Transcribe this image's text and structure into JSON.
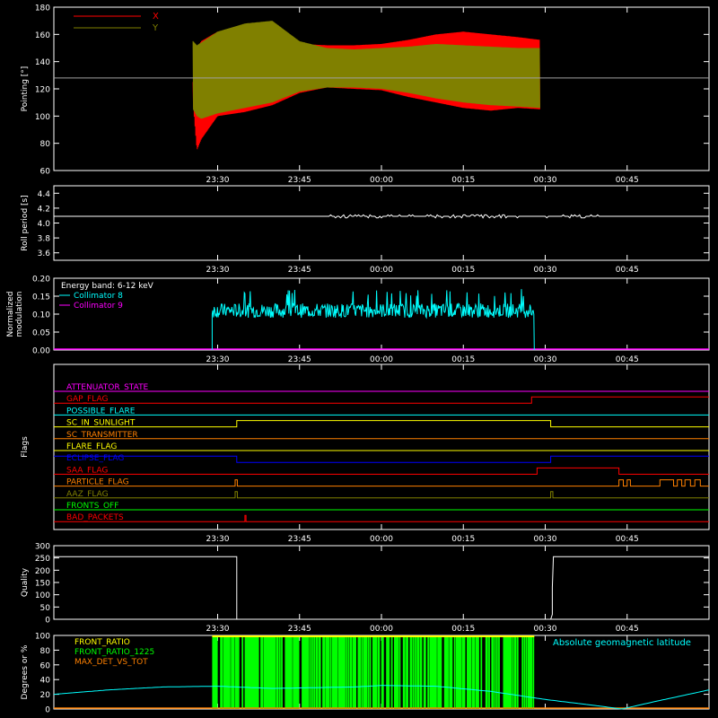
{
  "time_ticks": [
    "23:30",
    "23:45",
    "00:00",
    "00:15",
    "00:30",
    "00:45"
  ],
  "chart_data": [
    {
      "id": "pointing",
      "type": "line",
      "ylabel": "Pointing [°]",
      "ylim": [
        60,
        180
      ],
      "yticks": [
        60,
        80,
        100,
        120,
        140,
        160,
        180
      ],
      "ytick_labels": [
        "60",
        "80",
        "100",
        "120",
        "140",
        "160",
        "180"
      ],
      "xlim_minutes": [
        -30,
        90
      ],
      "grid": false,
      "legend": "top-left",
      "series": [
        {
          "name": "X",
          "color": "#ff0000",
          "kind": "oscillation",
          "t": [
            -4.5,
            -3.8,
            -3,
            0,
            5,
            10,
            15,
            20,
            25,
            30,
            35,
            40,
            45,
            50,
            55,
            59
          ],
          "hi": [
            125,
            150,
            155,
            162,
            166,
            165,
            153,
            152,
            152,
            153,
            156,
            160,
            162,
            160,
            158,
            156
          ],
          "lo": [
            110,
            75,
            83,
            100,
            103,
            108,
            117,
            121,
            120,
            119,
            114,
            110,
            106,
            104,
            106,
            105
          ]
        },
        {
          "name": "Y",
          "color": "#808000",
          "kind": "oscillation",
          "t": [
            -4.5,
            -3.8,
            -3,
            0,
            5,
            10,
            15,
            20,
            25,
            30,
            35,
            40,
            45,
            50,
            55,
            59
          ],
          "hi": [
            155,
            152,
            154,
            162,
            168,
            170,
            155,
            150,
            149,
            150,
            151,
            153,
            152,
            151,
            150,
            150
          ],
          "lo": [
            105,
            100,
            98,
            102,
            106,
            110,
            118,
            121,
            121,
            120,
            117,
            113,
            110,
            108,
            107,
            106
          ]
        }
      ],
      "reference_line": {
        "value": 128,
        "color": "#a0a0a0"
      }
    },
    {
      "id": "roll",
      "type": "line",
      "ylabel": "Roll period [s]",
      "ylim": [
        3.5,
        4.5
      ],
      "yticks": [
        3.6,
        3.8,
        4.0,
        4.2,
        4.4
      ],
      "ytick_labels": [
        "3.6",
        "3.8",
        "4.0",
        "4.2",
        "4.4"
      ],
      "series": [
        {
          "name": "",
          "color": "#ffffff",
          "value": 4.09,
          "jitter": 0.02
        }
      ]
    },
    {
      "id": "modulation",
      "type": "line",
      "ylabel": "Normalized modulation",
      "ylim": [
        0,
        0.2
      ],
      "yticks": [
        0,
        0.05,
        0.1,
        0.15,
        0.2
      ],
      "ytick_labels": [
        "0.00",
        "0.05",
        "0.10",
        "0.15",
        "0.20"
      ],
      "annotation": "Energy band: 6-12 keV",
      "legend": "top-left",
      "series": [
        {
          "name": "Collimator 8",
          "color": "#00ffff",
          "start": -1,
          "end": 58,
          "mean": 0.11,
          "noise": 0.02,
          "spikes": 0.17
        },
        {
          "name": "Collimator 9",
          "color": "#ff00ff",
          "value": 0.0
        }
      ]
    },
    {
      "id": "flags",
      "type": "line",
      "ylabel": "Flags",
      "flags": [
        {
          "name": "ATTENUATOR_STATE",
          "color": "#ff00ff",
          "segments": [
            [
              -30,
              0
            ]
          ]
        },
        {
          "name": "GAP_FLAG",
          "color": "#ff0000",
          "segments": [
            [
              -30,
              0
            ],
            [
              57.5,
              1
            ]
          ]
        },
        {
          "name": "POSSIBLE_FLARE",
          "color": "#00ffff",
          "segments": [
            [
              -30,
              0
            ]
          ]
        },
        {
          "name": "SC_IN_SUNLIGHT",
          "color": "#ffff00",
          "segments": [
            [
              -30,
              0
            ],
            [
              3.5,
              1
            ],
            [
              61,
              0
            ]
          ]
        },
        {
          "name": "SC_TRANSMITTER",
          "color": "#ff8000",
          "segments": [
            [
              -30,
              0
            ]
          ]
        },
        {
          "name": "FLARE_FLAG",
          "color": "#ffff00",
          "segments": [
            [
              -30,
              0
            ]
          ]
        },
        {
          "name": "ECLIPSE_FLAG",
          "color": "#0000ff",
          "segments": [
            [
              -30,
              1
            ],
            [
              3.5,
              0
            ],
            [
              61,
              1
            ]
          ]
        },
        {
          "name": "SAA_FLAG",
          "color": "#ff0000",
          "segments": [
            [
              -30,
              0
            ],
            [
              58.5,
              1
            ],
            [
              73.5,
              0
            ]
          ]
        },
        {
          "name": "PARTICLE_FLAG",
          "color": "#ff8000",
          "segments": [
            [
              -30,
              0
            ],
            [
              3.2,
              1
            ],
            [
              3.6,
              0
            ],
            [
              73.5,
              1
            ],
            [
              74.3,
              0
            ],
            [
              75,
              1
            ],
            [
              75.6,
              0
            ],
            [
              81,
              1
            ],
            [
              83.5,
              0
            ],
            [
              84.2,
              1
            ],
            [
              85,
              0
            ],
            [
              85.6,
              1
            ],
            [
              86.6,
              0
            ],
            [
              87.4,
              1
            ],
            [
              88.4,
              0
            ]
          ]
        },
        {
          "name": "AAZ_FLAG",
          "color": "#808000",
          "segments": [
            [
              -30,
              0
            ],
            [
              3.2,
              1
            ],
            [
              3.6,
              0
            ],
            [
              61,
              1
            ],
            [
              61.4,
              0
            ]
          ]
        },
        {
          "name": "FRONTS_OFF",
          "color": "#00ff00",
          "segments": [
            [
              -30,
              0
            ]
          ]
        },
        {
          "name": "BAD_PACKETS",
          "color": "#ff0000",
          "segments": [
            [
              -30,
              0
            ],
            [
              5,
              1
            ],
            [
              5.2,
              0
            ]
          ]
        }
      ]
    },
    {
      "id": "quality",
      "type": "line",
      "ylabel": "Quality",
      "ylim": [
        0,
        300
      ],
      "yticks": [
        0,
        50,
        100,
        150,
        200,
        250,
        300
      ],
      "ytick_labels": [
        "0",
        "50",
        "100",
        "150",
        "200",
        "250",
        "300"
      ],
      "series": [
        {
          "name": "",
          "color": "#ffffff",
          "x": [
            -30,
            3.5,
            3.5,
            61,
            61.3,
            61.3,
            61.5,
            90
          ],
          "y": [
            255,
            255,
            0,
            0,
            20,
            130,
            255,
            255
          ]
        }
      ]
    },
    {
      "id": "ratios",
      "type": "line",
      "ylabel": "Degrees or %",
      "ylim": [
        0,
        100
      ],
      "yticks": [
        0,
        20,
        40,
        60,
        80,
        100
      ],
      "ytick_labels": [
        "0",
        "20",
        "40",
        "60",
        "80",
        "100"
      ],
      "legend": "top-left",
      "right_label": "Absolute geomagnetic latitude",
      "right_label_color": "#00ffff",
      "series": [
        {
          "name": "FRONT_RATIO",
          "color": "#ffff00",
          "start": -1,
          "end": 58,
          "level": 100
        },
        {
          "name": "FRONT_RATIO_1225",
          "color": "#00ff00",
          "start": -1,
          "end": 58,
          "level": 100,
          "bars": true
        },
        {
          "name": "MAX_DET_VS_TOT",
          "color": "#ff8000",
          "level": 0
        },
        {
          "name": "latitude",
          "color": "#00ffff",
          "x": [
            -30,
            -20,
            -10,
            0,
            10,
            25,
            30,
            40,
            50,
            60,
            70,
            74,
            80,
            90
          ],
          "y": [
            20,
            26,
            30,
            31,
            28,
            30,
            32,
            31,
            24,
            13,
            4,
            0,
            10,
            26
          ]
        }
      ]
    }
  ]
}
